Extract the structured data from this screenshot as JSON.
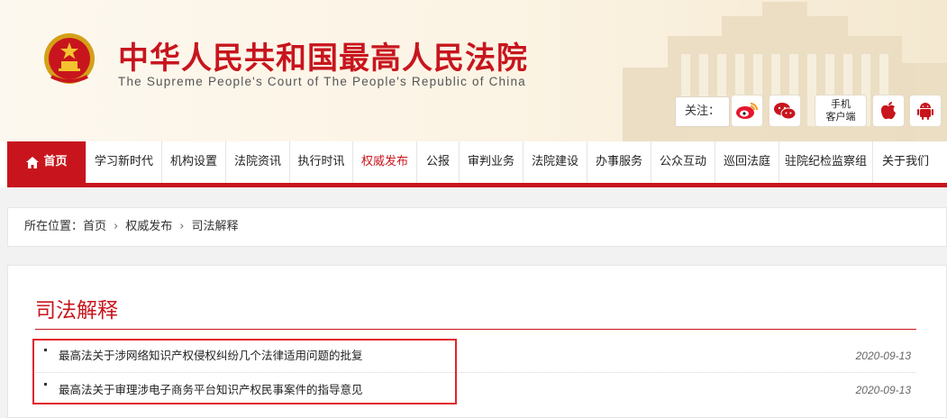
{
  "header": {
    "title": "中华人民共和国最高人民法院",
    "subtitle": "The Supreme People's Court of The People's Republic of China",
    "follow_label": "关注：",
    "mobile_label_line1": "手机",
    "mobile_label_line2": "客户端",
    "social_icons": [
      "weibo-icon",
      "wechat-icon",
      "apple-icon",
      "android-icon"
    ]
  },
  "nav": {
    "items": [
      {
        "label": "首页"
      },
      {
        "label": "学习新时代"
      },
      {
        "label": "机构设置"
      },
      {
        "label": "法院资讯"
      },
      {
        "label": "执行时讯"
      },
      {
        "label": "权威发布"
      },
      {
        "label": "公报"
      },
      {
        "label": "审判业务"
      },
      {
        "label": "法院建设"
      },
      {
        "label": "办事服务"
      },
      {
        "label": "公众互动"
      },
      {
        "label": "巡回法庭"
      },
      {
        "label": "驻院纪检监察组"
      },
      {
        "label": "关于我们"
      }
    ]
  },
  "breadcrumb": {
    "prefix": "所在位置：",
    "items": [
      "首页",
      "权威发布",
      "司法解释"
    ]
  },
  "section": {
    "title": "司法解释",
    "rows": [
      {
        "title": "最高法关于涉网络知识产权侵权纠纷几个法律适用问题的批复",
        "date": "2020-09-13"
      },
      {
        "title": "最高法关于审理涉电子商务平台知识产权民事案件的指导意见",
        "date": "2020-09-13"
      }
    ]
  },
  "colors": {
    "brand_red": "#c8151d",
    "highlight_red": "#e0252d"
  }
}
